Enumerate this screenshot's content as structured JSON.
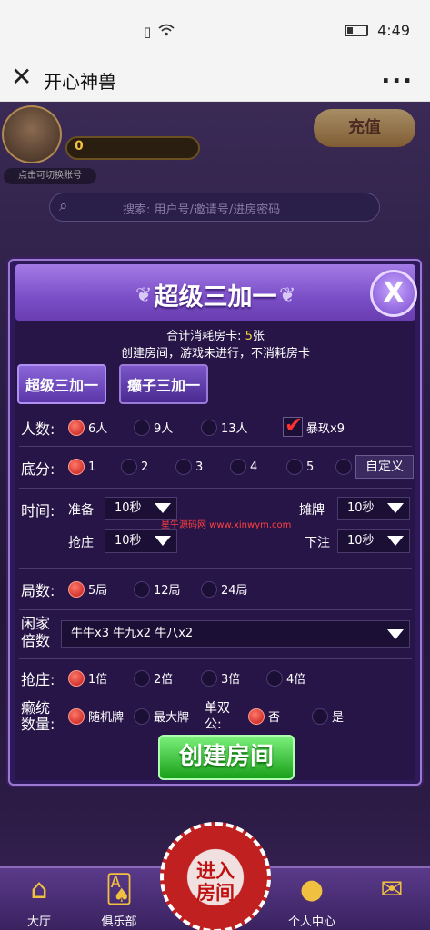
{
  "status_bar": {
    "time": "4:49"
  },
  "title_bar": {
    "title": "开心神兽",
    "more": "..."
  },
  "game_top": {
    "gold": "0",
    "switch_tip": "点击可切换账号",
    "recharge": "充值",
    "search_placeholder": "搜索: 用户号/邀请号/进房密码"
  },
  "dialog": {
    "title": "超级三加一",
    "cost_prefix": "合计消耗房卡: ",
    "cost_value": "5",
    "cost_suffix": "张",
    "notice": "创建房间，游戏未进行，不消耗房卡",
    "modes": [
      "超级三加一",
      "癞子三加一"
    ],
    "players": {
      "label": "人数:",
      "options": [
        "6人",
        "9人",
        "13人"
      ],
      "selected": 0,
      "extra": {
        "label": "暴玖x9",
        "checked": true
      }
    },
    "base": {
      "label": "底分:",
      "options": [
        "1",
        "2",
        "3",
        "4",
        "5"
      ],
      "selected": 0,
      "custom": "自定义"
    },
    "time": {
      "label": "时间:",
      "prepare_label": "准备",
      "prepare_value": "10秒",
      "show_label": "摊牌",
      "show_value": "10秒",
      "grab_label": "抢庄",
      "grab_value": "10秒",
      "bet_label": "下注",
      "bet_value": "10秒"
    },
    "rounds": {
      "label": "局数:",
      "options": [
        "5局",
        "12局",
        "24局"
      ],
      "selected": 0
    },
    "multiplier": {
      "label_line1": "闲家",
      "label_line2": "倍数",
      "value": "牛牛x3 牛九x2 牛八x2"
    },
    "grab": {
      "label": "抢庄:",
      "options": [
        "1倍",
        "2倍",
        "3倍",
        "4倍"
      ],
      "selected": 0
    },
    "joker": {
      "label_line1": "癞统",
      "label_line2": "数量:",
      "options": [
        "随机牌",
        "最大牌"
      ],
      "selected": 0,
      "single_double_label": "单双公:",
      "sd_options": [
        "否",
        "是"
      ],
      "sd_selected": 0
    },
    "create_button": "创建房间",
    "watermark": "星午源码网 www.xinwym.com"
  },
  "bottom": {
    "enter_room": "进入房间",
    "nav": [
      "大厅",
      "俱乐部",
      "个人中心"
    ]
  },
  "colors": {
    "accent": "#7a4ec6",
    "create": "#1aa01a",
    "radio_on": "#c01818"
  }
}
